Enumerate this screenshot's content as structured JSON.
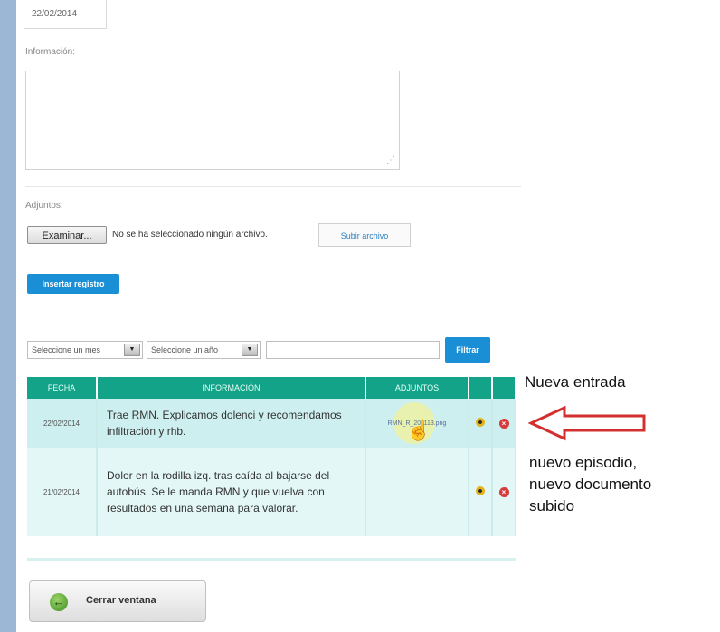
{
  "form": {
    "date_value": "22/02/2014",
    "info_label": "Información:",
    "attachments_label": "Adjuntos:",
    "browse_button": "Examinar...",
    "no_file_text": "No se ha seleccionado ningún archivo.",
    "upload_button": "Subir archivo",
    "insert_button": "Insertar registro"
  },
  "filter": {
    "month_select": "Seleccione un mes",
    "year_select": "Seleccione un año",
    "search_value": "",
    "filter_button": "Filtrar"
  },
  "table": {
    "headers": [
      "FECHA",
      "INFORMACIÓN",
      "ADJUNTOS",
      "",
      ""
    ],
    "rows": [
      {
        "fecha": "22/02/2014",
        "info": "Trae RMN. Explicamos dolenci y recomendamos infiltración y rhb.",
        "adjunto": "RMN_R_201113.png"
      },
      {
        "fecha": "21/02/2014",
        "info": "Dolor en la rodilla izq. tras caída al bajarse del autobús. Se le manda RMN y que vuelva con resultados en una semana para valorar.",
        "adjunto": ""
      }
    ]
  },
  "footer": {
    "close_button": "Cerrar ventana"
  },
  "annotations": {
    "new_entry": "Nueva entrada",
    "new_episode": "nuevo episodio,\nnuevo documento\nsubido"
  },
  "icons": {
    "view": "view-icon",
    "delete": "delete-icon",
    "close": "back-arrow-icon",
    "arrow": "red-arrow-icon"
  },
  "colors": {
    "table_header": "#12a388",
    "row_highlight": "#cdefef",
    "button_blue": "#1a8fd6",
    "arrow_red": "#d32f2f"
  }
}
